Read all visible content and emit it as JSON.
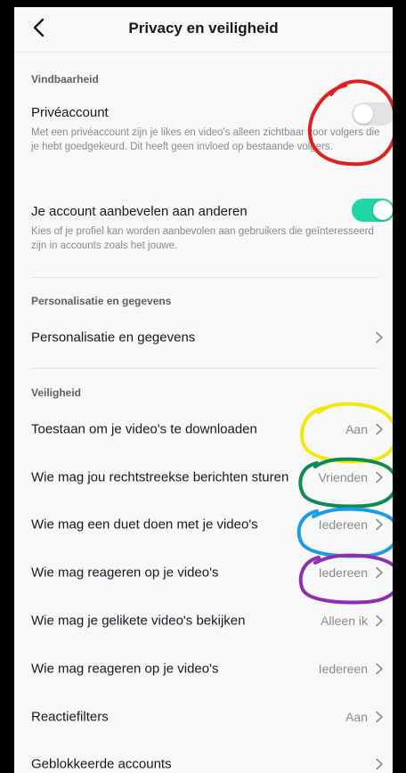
{
  "header": {
    "title": "Privacy en veiligheid",
    "back_icon": "chevron-left-icon"
  },
  "sections": {
    "findability": {
      "title": "Vindbaarheid",
      "private_account": {
        "label": "Privéaccount",
        "description": "Met een privéaccount zijn je likes en video's alleen zichtbaar voor volgers die je hebt goedgekeurd. Dit heeft geen invloed op bestaande volgers.",
        "enabled": false
      },
      "suggest_account": {
        "label": "Je account aanbevelen aan anderen",
        "description": "Kies of je profiel kan worden aanbevolen aan gebruikers die geïnteresseerd zijn in accounts zoals het jouwe.",
        "enabled": true
      }
    },
    "personalization": {
      "title": "Personalisatie en gegevens",
      "item_label": "Personalisatie en gegevens"
    },
    "safety": {
      "title": "Veiligheid",
      "items": [
        {
          "label": "Toestaan om je video's te downloaden",
          "value": "Aan"
        },
        {
          "label": "Wie mag jou rechtstreekse berichten sturen",
          "value": "Vrienden"
        },
        {
          "label": "Wie mag een duet doen met je video's",
          "value": "Iedereen"
        },
        {
          "label": "Wie mag reageren op je video's",
          "value": "Iedereen"
        },
        {
          "label": "Wie mag je gelikete video's bekijken",
          "value": "Alleen ik"
        },
        {
          "label": "Wie mag reageren op je video's",
          "value": "Iedereen"
        },
        {
          "label": "Reactiefilters",
          "value": "Aan"
        },
        {
          "label": "Geblokkeerde accounts",
          "value": ""
        }
      ]
    }
  },
  "colors": {
    "toggle_on": "#20d5a6",
    "toggle_off": "#e3e3e4",
    "annotation_red": "#e0201c",
    "annotation_yellow": "#f5e60f",
    "annotation_green": "#0f8a55",
    "annotation_blue": "#1e9be6",
    "annotation_purple": "#8d2fb0"
  }
}
